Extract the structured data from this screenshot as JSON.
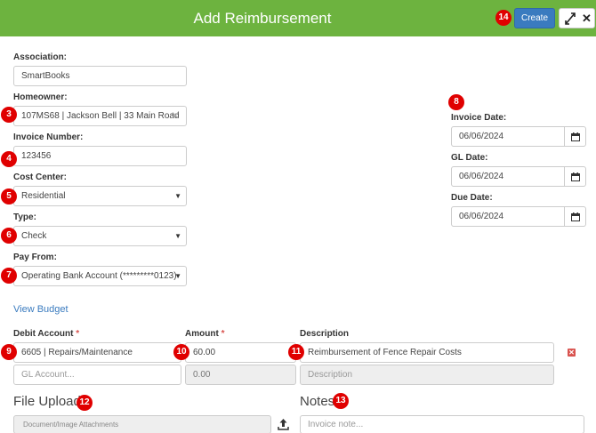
{
  "header": {
    "title": "Add Reimbursement",
    "create_label": "Create",
    "close_glyph": "✕",
    "expand_icon": "expand-icon",
    "color": "#6db33f"
  },
  "form": {
    "association": {
      "label": "Association:",
      "value": "SmartBooks"
    },
    "homeowner": {
      "label": "Homeowner:",
      "value": "107MS68 | Jackson Bell | 33 Main Road",
      "clear_glyph": "✕"
    },
    "invoice_number": {
      "label": "Invoice Number:",
      "value": "123456"
    },
    "cost_center": {
      "label": "Cost Center:",
      "value": "Residential"
    },
    "type": {
      "label": "Type:",
      "value": "Check"
    },
    "pay_from": {
      "label": "Pay From:",
      "value": "Operating Bank Account (*********0123)"
    },
    "invoice_date": {
      "label": "Invoice Date:",
      "value": "06/06/2024"
    },
    "gl_date": {
      "label": "GL Date:",
      "value": "06/06/2024"
    },
    "due_date": {
      "label": "Due Date:",
      "value": "06/06/2024"
    }
  },
  "view_budget": "View Budget",
  "lines": {
    "headers": {
      "debit_account": "Debit Account",
      "amount": "Amount",
      "description": "Description",
      "required_mark": "*"
    },
    "row1": {
      "account": "6605 | Repairs/Maintenance",
      "amount": "60.00",
      "description": "Reimbursement of Fence Repair Costs",
      "delete_glyph": "✕"
    },
    "row2": {
      "account_placeholder": "GL Account...",
      "amount": "0.00",
      "description_placeholder": "Description"
    }
  },
  "file_upload": {
    "title": "File Upload",
    "placeholder": "Document/Image Attachments"
  },
  "notes": {
    "title": "Notes",
    "placeholder": "Invoice note..."
  },
  "markers": [
    "3",
    "4",
    "5",
    "6",
    "7",
    "8",
    "9",
    "10",
    "11",
    "12",
    "13",
    "14"
  ],
  "select_arrow": "▼"
}
